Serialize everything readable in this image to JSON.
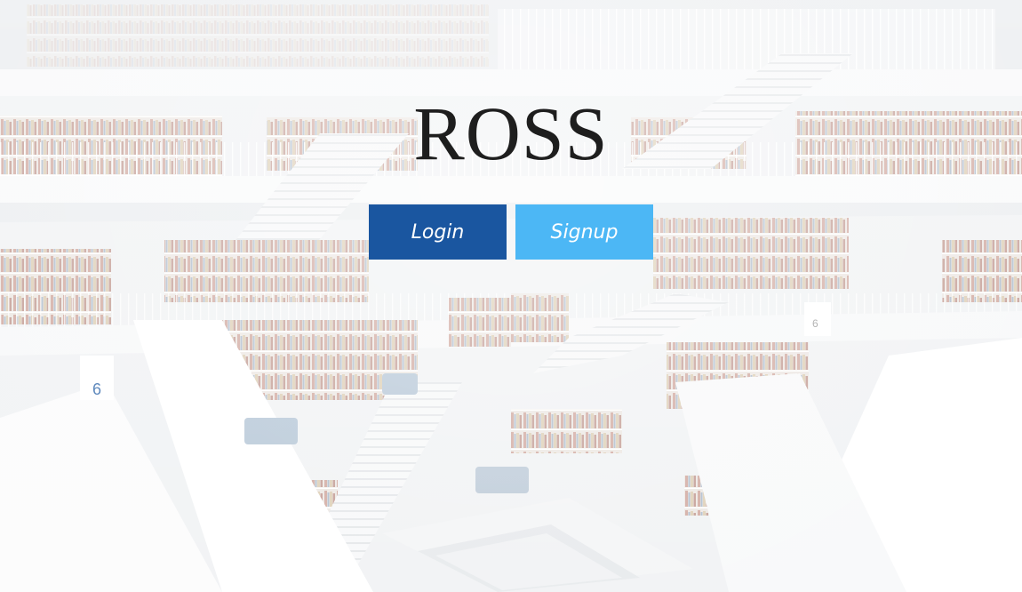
{
  "brand": {
    "title": "ROSS"
  },
  "actions": {
    "login_label": "Login",
    "signup_label": "Signup"
  },
  "background": {
    "wall_sign": "6",
    "wall_sign_right": "6"
  },
  "colors": {
    "login_bg": "#1a56a0",
    "signup_bg": "#4cb7f5",
    "title_text": "#1e1e1e"
  }
}
